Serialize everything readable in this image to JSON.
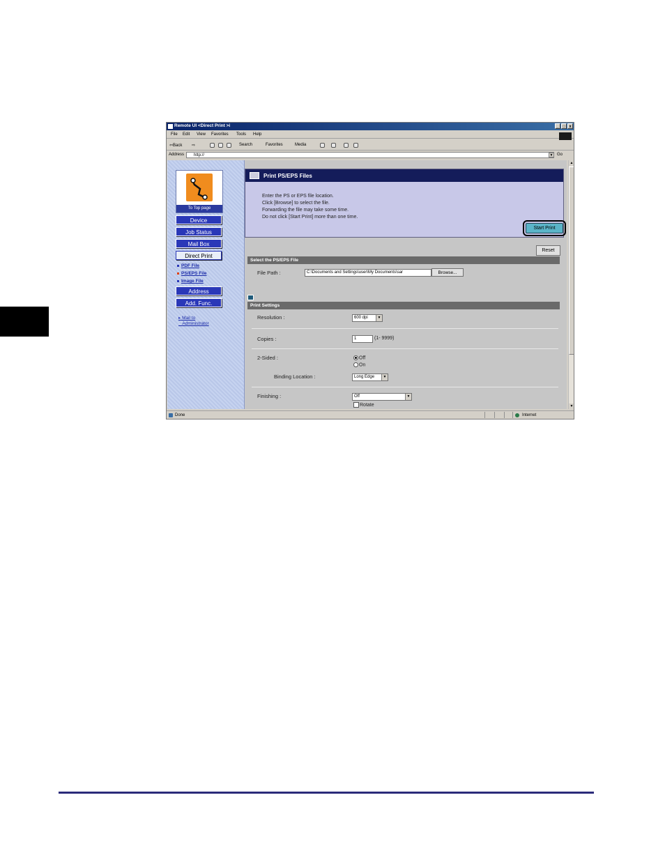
{
  "window": {
    "title": "Remote UI <Direct Print >i",
    "controls": [
      "_",
      "□",
      "x"
    ]
  },
  "menu": [
    "File",
    "Edit",
    "View",
    "Favorites",
    "Tools",
    "Help"
  ],
  "toolbar": {
    "back": "⇦Back",
    "forward": "⇨",
    "search": "Search",
    "favorites": "Favorites",
    "media": "Media"
  },
  "address": {
    "label": "Address",
    "value": "http://",
    "go": "Go"
  },
  "nav": {
    "top_page": "To Top page",
    "buttons": [
      "Device",
      "Job Status",
      "Mail Box",
      "Direct Print",
      "Address",
      "Add. Func."
    ],
    "sub_links": [
      "PDF File",
      "PS/EPS File",
      "Image File"
    ],
    "mail_line1": "Mail to",
    "mail_line2": "Administrator"
  },
  "panel": {
    "title": "Print PS/EPS Files",
    "lines": [
      "Enter the PS or EPS file location.",
      "Click [Browse] to select the file.",
      "Forwarding the file may take some time.",
      "Do not click [Start Print] more than one time."
    ],
    "start_print": "Start Print"
  },
  "reset": "Reset",
  "select_section": {
    "header": "Select the PS/EPS File",
    "file_path_label": "File Path :",
    "file_path_value": "C:\\Documents and Settings\\user\\My Documents\\sar",
    "browse": "Browse..."
  },
  "print_settings": {
    "header": "Print Settings",
    "resolution_label": "Resolution :",
    "resolution_value": "600 dpi",
    "copies_label": "Copies :",
    "copies_value": "1",
    "copies_range": "(1- 9999)",
    "sided_label": "2-Sided :",
    "sided_off": "Off",
    "sided_on": "On",
    "binding_label": "Binding Location :",
    "binding_value": "Long Edge",
    "finishing_label": "Finishing :",
    "finishing_value": "Off",
    "rotate": "Rotate"
  },
  "status": {
    "left": "Done",
    "zone": "Internet"
  }
}
